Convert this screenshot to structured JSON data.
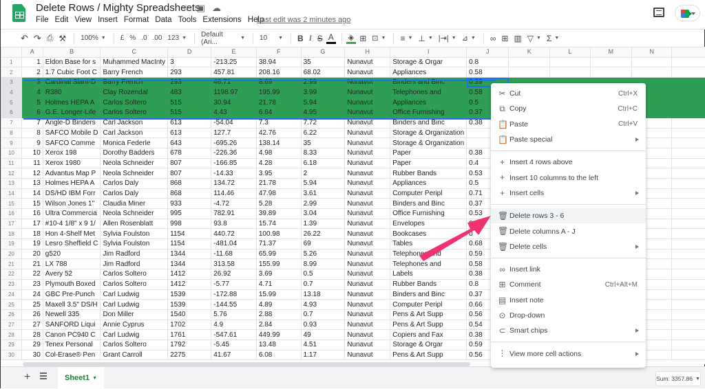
{
  "app": {
    "title": "Delete Rows / Mighty Spreadsheets",
    "last_edit": "Last edit was 2 minutes ago",
    "menu": [
      "File",
      "Edit",
      "View",
      "Insert",
      "Format",
      "Data",
      "Tools",
      "Extensions",
      "Help"
    ]
  },
  "toolbar": {
    "zoom": "100%",
    "currency": "£",
    "percent": "%",
    "dec_less": ".0",
    "dec_more": ".00",
    "more_formats": "123",
    "font": "Default (Ari...",
    "font_size": "10",
    "bold": "B",
    "italic": "I",
    "strike": "S",
    "text_color": "A"
  },
  "grid": {
    "columns": [
      "A",
      "B",
      "C",
      "D",
      "E",
      "F",
      "G",
      "H",
      "I",
      "J",
      "K",
      "L",
      "M",
      "N",
      ""
    ],
    "selected_rows": [
      3,
      4,
      5,
      6
    ],
    "active_cell": "J3",
    "rows": [
      [
        "1",
        "Eldon Base for s",
        "Muhammed MacInty",
        "3",
        "-213.25",
        "38.94",
        "35",
        "Nunavut",
        "Storage & Orgar",
        "0.8"
      ],
      [
        "2",
        "1.7 Cubic Foot C",
        "Barry French",
        "293",
        "457.81",
        "208.16",
        "68.02",
        "Nunavut",
        "Appliances",
        "0.58"
      ],
      [
        "3",
        "Cardinal Slant-D",
        "Barry French",
        "293",
        "46.71",
        "8.69",
        "2.99",
        "Nunavut",
        "Binders and Binc",
        "0.39"
      ],
      [
        "4",
        "R380",
        "Clay Rozendal",
        "483",
        "1198.97",
        "195.99",
        "3.99",
        "Nunavut",
        "Telephones and",
        "0.58"
      ],
      [
        "5",
        "Holmes HEPA A",
        "Carlos Soltero",
        "515",
        "30.94",
        "21.78",
        "5.94",
        "Nunavut",
        "Appliances",
        "0.5"
      ],
      [
        "6",
        "G.E. Longer-Life",
        "Carlos Soltero",
        "515",
        "4.43",
        "6.64",
        "4.95",
        "Nunavut",
        "Office Furnishing",
        "0.37"
      ],
      [
        "7",
        "Angle-D Binders",
        "Carl Jackson",
        "613",
        "-54.04",
        "7.3",
        "7.72",
        "Nunavut",
        "Binders and Binc",
        "0.38"
      ],
      [
        "8",
        "SAFCO Mobile D",
        "Carl Jackson",
        "613",
        "127.7",
        "42.76",
        "6.22",
        "Nunavut",
        "Storage & Organization",
        ""
      ],
      [
        "9",
        "SAFCO Comme",
        "Monica Federle",
        "643",
        "-695.26",
        "138.14",
        "35",
        "Nunavut",
        "Storage & Organization",
        ""
      ],
      [
        "10",
        "Xerox 198",
        "Dorothy Badders",
        "678",
        "-226.36",
        "4.98",
        "8.33",
        "Nunavut",
        "Paper",
        "0.38"
      ],
      [
        "11",
        "Xerox 1980",
        "Neola Schneider",
        "807",
        "-166.85",
        "4.28",
        "6.18",
        "Nunavut",
        "Paper",
        "0.4"
      ],
      [
        "12",
        "Advantus Map P",
        "Neola Schneider",
        "807",
        "-14.33",
        "3.95",
        "2",
        "Nunavut",
        "Rubber Bands",
        "0.53"
      ],
      [
        "13",
        "Holmes HEPA A",
        "Carlos Daly",
        "868",
        "134.72",
        "21.78",
        "5.94",
        "Nunavut",
        "Appliances",
        "0.5"
      ],
      [
        "14",
        "DS/HD IBM Forr",
        "Carlos Daly",
        "868",
        "114.46",
        "47.98",
        "3.61",
        "Nunavut",
        "Computer Peripl",
        "0.71"
      ],
      [
        "15",
        "Wilson Jones 1\"",
        "Claudia Miner",
        "933",
        "-4.72",
        "5.28",
        "2.99",
        "Nunavut",
        "Binders and Binc",
        "0.37"
      ],
      [
        "16",
        "Ultra Commercia",
        "Neola Schneider",
        "995",
        "782.91",
        "39.89",
        "3.04",
        "Nunavut",
        "Office Furnishing",
        "0.53"
      ],
      [
        "17",
        "#10-4 1/8\" x 9 1/",
        "Allen Rosenblatt",
        "998",
        "93.8",
        "15.74",
        "1.39",
        "Nunavut",
        "Envelopes",
        "0.4"
      ],
      [
        "18",
        "Hon 4-Shelf Met",
        "Sylvia Foulston",
        "1154",
        "440.72",
        "100.98",
        "26.22",
        "Nunavut",
        "Bookcases",
        "0"
      ],
      [
        "19",
        "Lesro Sheffield C",
        "Sylvia Foulston",
        "1154",
        "-481.04",
        "71.37",
        "69",
        "Nunavut",
        "Tables",
        "0.68"
      ],
      [
        "20",
        "g520",
        "Jim Radford",
        "1344",
        "-11.68",
        "65.99",
        "5.26",
        "Nunavut",
        "Telephones and",
        "0.59"
      ],
      [
        "21",
        "LX 788",
        "Jim Radford",
        "1344",
        "313.58",
        "155.99",
        "8.99",
        "Nunavut",
        "Telephones and",
        "0.58"
      ],
      [
        "22",
        "Avery 52",
        "Carlos Soltero",
        "1412",
        "26.92",
        "3.69",
        "0.5",
        "Nunavut",
        "Labels",
        "0.38"
      ],
      [
        "23",
        "Plymouth Boxed",
        "Carlos Soltero",
        "1412",
        "-5.77",
        "4.71",
        "0.7",
        "Nunavut",
        "Rubber Bands",
        "0.8"
      ],
      [
        "24",
        "GBC Pre-Punch",
        "Carl Ludwig",
        "1539",
        "-172.88",
        "15.99",
        "13.18",
        "Nunavut",
        "Binders and Binc",
        "0.37"
      ],
      [
        "25",
        "Maxell 3.5\" DS/H",
        "Carl Ludwig",
        "1539",
        "-144.55",
        "4.89",
        "4.93",
        "Nunavut",
        "Computer Peripl",
        "0.66"
      ],
      [
        "26",
        "Newell 335",
        "Don Miller",
        "1540",
        "5.76",
        "2.88",
        "0.7",
        "Nunavut",
        "Pens & Art Supp",
        "0.56"
      ],
      [
        "27",
        "SANFORD Liqui",
        "Annie Cyprus",
        "1702",
        "4.9",
        "2.84",
        "0.93",
        "Nunavut",
        "Pens & Art Supp",
        "0.54"
      ],
      [
        "28",
        "Canon PC940 C",
        "Carl Ludwig",
        "1761",
        "-547.61",
        "449.99",
        "49",
        "Nunavut",
        "Copiers and Fax",
        "0.38"
      ],
      [
        "29",
        "Tenex Personal",
        "Carlos Soltero",
        "1792",
        "-5.45",
        "13.48",
        "4.51",
        "Nunavut",
        "Storage & Orgar",
        "0.59"
      ],
      [
        "30",
        "Col-Erase® Pen",
        "Grant Carroll",
        "2275",
        "41.67",
        "6.08",
        "1.17",
        "Nunavut",
        "Pens & Art Supp",
        "0.56"
      ]
    ]
  },
  "context_menu": {
    "groups": [
      [
        {
          "icon": "scissors-icon",
          "glyph": "✂",
          "label": "Cut",
          "shortcut": "Ctrl+X"
        },
        {
          "icon": "copy-icon",
          "glyph": "⧉",
          "label": "Copy",
          "shortcut": "Ctrl+C"
        },
        {
          "icon": "clipboard-icon",
          "glyph": "📋",
          "label": "Paste",
          "shortcut": "Ctrl+V"
        },
        {
          "icon": "clipboard-icon",
          "glyph": "📋",
          "label": "Paste special",
          "submenu": true
        }
      ],
      [
        {
          "icon": "plus-icon",
          "glyph": "+",
          "label": "Insert 4 rows above"
        },
        {
          "icon": "plus-icon",
          "glyph": "+",
          "label": "Insert 10 columns to the left"
        },
        {
          "icon": "plus-icon",
          "glyph": "+",
          "label": "Insert cells",
          "submenu": true
        }
      ],
      [
        {
          "icon": "trash-icon",
          "glyph": "🗑",
          "label": "Delete rows 3 - 6",
          "highlighted": true
        },
        {
          "icon": "trash-icon",
          "glyph": "🗑",
          "label": "Delete columns A - J"
        },
        {
          "icon": "trash-icon",
          "glyph": "🗑",
          "label": "Delete cells",
          "submenu": true
        }
      ],
      [
        {
          "icon": "link-icon",
          "glyph": "∞",
          "label": "Insert link"
        },
        {
          "icon": "comment-icon",
          "glyph": "⊞",
          "label": "Comment",
          "shortcut": "Ctrl+Alt+M"
        },
        {
          "icon": "note-icon",
          "glyph": "▤",
          "label": "Insert note"
        },
        {
          "icon": "dropdown-icon",
          "glyph": "⊙",
          "label": "Drop-down"
        },
        {
          "icon": "smart-chips-icon",
          "glyph": "⊂",
          "label": "Smart chips",
          "submenu": true
        }
      ],
      [
        {
          "icon": "more-vert-icon",
          "glyph": "⋮",
          "label": "View more cell actions",
          "submenu": true
        }
      ]
    ]
  },
  "bottom": {
    "sheet_tab": "Sheet1",
    "sum": "Sum: 3357.86"
  },
  "colors": {
    "selection": "#2e9e56",
    "accent": "#1a73e8",
    "arrow": "#f0336e",
    "sheet_tab": "#188038"
  }
}
